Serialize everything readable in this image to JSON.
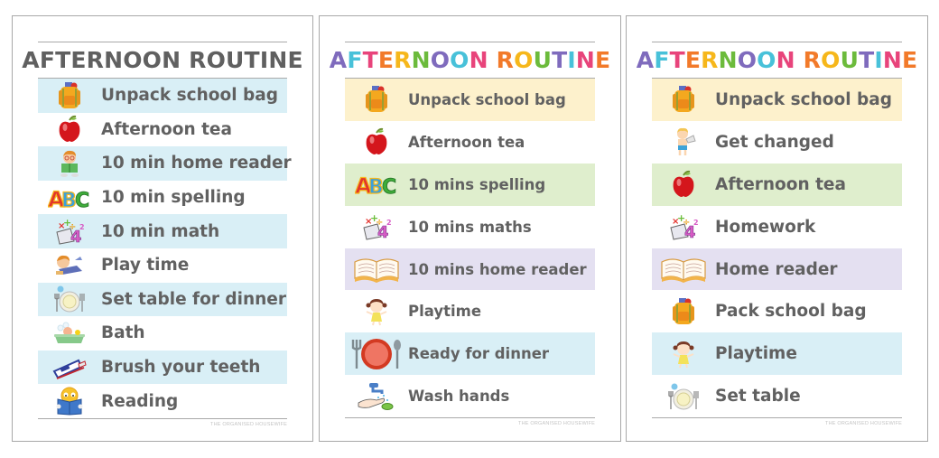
{
  "colors": {
    "text": "#616161",
    "rule": "#a9a9a9",
    "panel_border": "#a8a8a8",
    "row_blue": "#d9eff6",
    "row_yellow": "#fdf1cc",
    "row_green": "#dfeecd",
    "row_purple": "#e4e0f1",
    "title_palette": [
      "#7f6bbd",
      "#48c1d9",
      "#e8447b",
      "#f27a2a",
      "#f6b71b",
      "#6cbb3c"
    ]
  },
  "charts": [
    {
      "title": "AFTERNOON ROUTINE",
      "title_style": "gray",
      "footer": "THE ORGANISED HOUSEWIFE",
      "items": [
        {
          "label": "Unpack school bag",
          "icon": "school-bag-icon",
          "bg": "blue"
        },
        {
          "label": "Afternoon tea",
          "icon": "apple-icon",
          "bg": "none"
        },
        {
          "label": "10 min home reader",
          "icon": "boy-reading-icon",
          "bg": "blue"
        },
        {
          "label": "10 min spelling",
          "icon": "abc-icon",
          "bg": "none"
        },
        {
          "label": "10 min math",
          "icon": "math-book-icon",
          "bg": "blue"
        },
        {
          "label": "Play time",
          "icon": "boy-playing-icon",
          "bg": "none"
        },
        {
          "label": "Set table for dinner",
          "icon": "place-setting-icon",
          "bg": "blue"
        },
        {
          "label": "Bath",
          "icon": "bathtub-icon",
          "bg": "none"
        },
        {
          "label": "Brush your teeth",
          "icon": "toothbrush-icon",
          "bg": "blue"
        },
        {
          "label": "Reading",
          "icon": "smiley-reading-icon",
          "bg": "none"
        }
      ]
    },
    {
      "title": "AFTERNOON ROUTINE",
      "title_style": "rainbow",
      "footer": "THE ORGANISED HOUSEWIFE",
      "items": [
        {
          "label": "Unpack school bag",
          "icon": "school-bag-icon",
          "bg": "yellow"
        },
        {
          "label": "Afternoon tea",
          "icon": "apple-icon",
          "bg": "none"
        },
        {
          "label": "10 mins spelling",
          "icon": "abc-icon",
          "bg": "green"
        },
        {
          "label": "10 mins maths",
          "icon": "math-book-icon",
          "bg": "none"
        },
        {
          "label": "10 mins home reader",
          "icon": "open-book-icon",
          "bg": "purple"
        },
        {
          "label": "Playtime",
          "icon": "girl-playing-icon",
          "bg": "none"
        },
        {
          "label": "Ready for dinner",
          "icon": "dinner-plate-icon",
          "bg": "blue"
        },
        {
          "label": "Wash hands",
          "icon": "wash-hands-icon",
          "bg": "none"
        }
      ]
    },
    {
      "title": "AFTERNOON ROUTINE",
      "title_style": "rainbow",
      "footer": "THE ORGANISED HOUSEWIFE",
      "items": [
        {
          "label": "Unpack school bag",
          "icon": "school-bag-icon",
          "bg": "yellow"
        },
        {
          "label": "Get changed",
          "icon": "boy-changing-icon",
          "bg": "none"
        },
        {
          "label": "Afternoon tea",
          "icon": "apple-icon",
          "bg": "green"
        },
        {
          "label": "Homework",
          "icon": "math-book-icon",
          "bg": "none"
        },
        {
          "label": "Home reader",
          "icon": "open-book-icon",
          "bg": "purple"
        },
        {
          "label": "Pack school bag",
          "icon": "school-bag-icon",
          "bg": "none"
        },
        {
          "label": "Playtime",
          "icon": "girl-playing-icon",
          "bg": "blue"
        },
        {
          "label": "Set table",
          "icon": "place-setting-icon",
          "bg": "none"
        }
      ]
    }
  ]
}
